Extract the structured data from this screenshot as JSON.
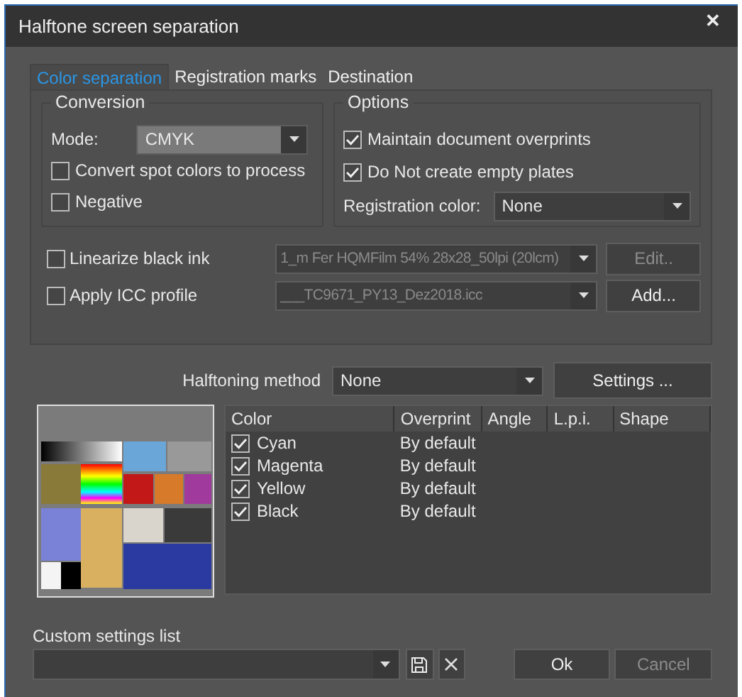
{
  "window": {
    "title": "Halftone screen separation",
    "close": "✕"
  },
  "tabs": [
    {
      "label": "Color separation",
      "selected": true
    },
    {
      "label": "Registration marks",
      "selected": false
    },
    {
      "label": "Destination",
      "selected": false
    }
  ],
  "conversion": {
    "title": "Conversion",
    "mode_label": "Mode:",
    "mode_value": "CMYK",
    "options": [
      {
        "label": "Convert spot colors to process",
        "checked": false
      },
      {
        "label": "Negative",
        "checked": false
      }
    ]
  },
  "options": {
    "title": "Options",
    "checkboxes": [
      {
        "label": "Maintain document overprints",
        "checked": true
      },
      {
        "label": "Do Not create empty plates",
        "checked": true
      }
    ],
    "registration_label": "Registration color:",
    "registration_value": "None"
  },
  "profiles": [
    {
      "label": "Linearize black ink",
      "checked": false,
      "value": "1_m Fer HQMFilm 54% 28x28_50lpi (20lcm)",
      "disabled": true,
      "button": "Edit..",
      "button_disabled": true
    },
    {
      "label": "Apply ICC profile",
      "checked": false,
      "value": "___TC9671_PY13_Dez2018.icc",
      "disabled": true,
      "button": "Add...",
      "button_disabled": false
    }
  ],
  "halftoning": {
    "label": "Halftoning method",
    "value": "None",
    "button": "Settings ..."
  },
  "table": {
    "columns": [
      "Color",
      "Overprint",
      "Angle",
      "L.p.i.",
      "Shape"
    ],
    "rows": [
      {
        "checked": true,
        "name": "Cyan",
        "overprint": "By default"
      },
      {
        "checked": true,
        "name": "Magenta",
        "overprint": "By default"
      },
      {
        "checked": true,
        "name": "Yellow",
        "overprint": "By default"
      },
      {
        "checked": true,
        "name": "Black",
        "overprint": "By default"
      }
    ]
  },
  "custom_settings": {
    "label": "Custom settings list"
  },
  "buttons": [
    {
      "label": "Ok",
      "disabled": false
    },
    {
      "label": "Cancel",
      "disabled": true
    }
  ]
}
